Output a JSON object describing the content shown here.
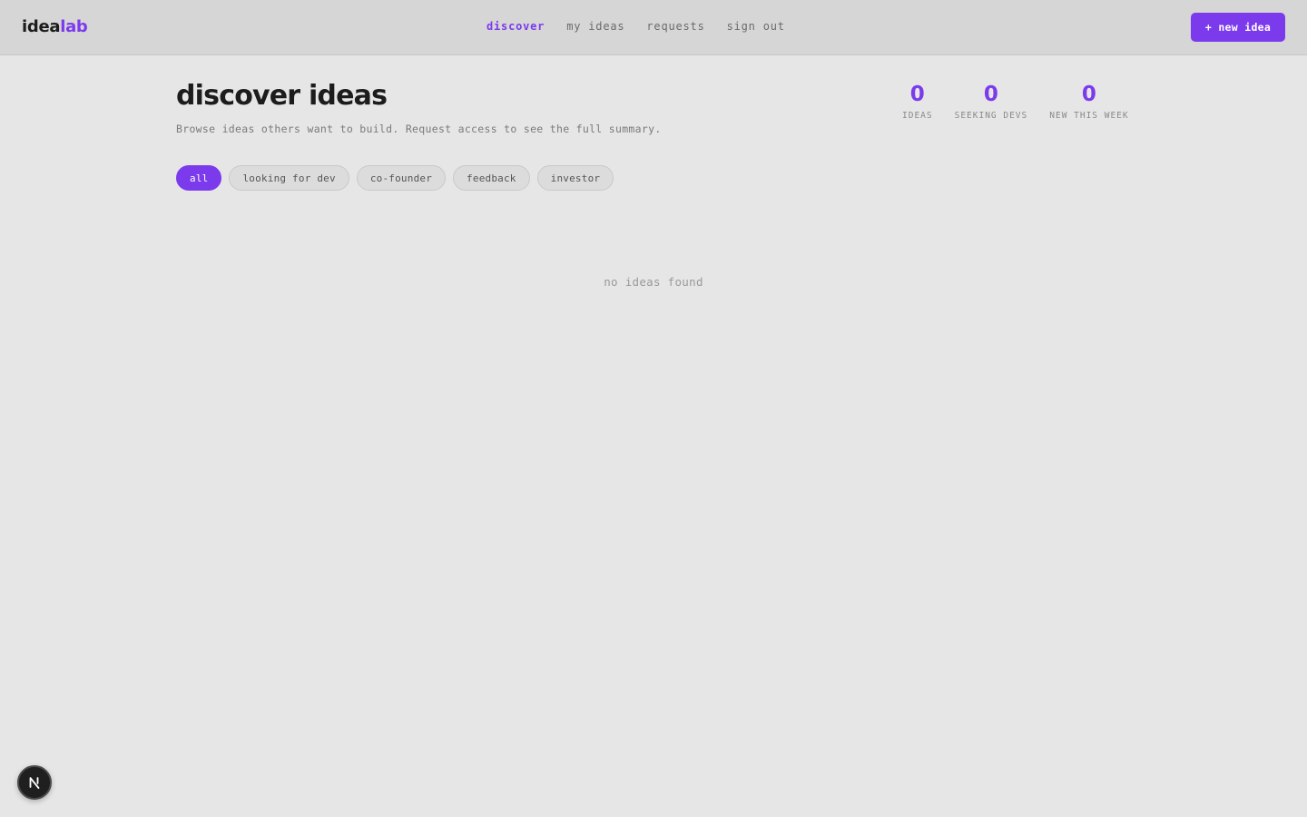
{
  "brand": {
    "name_main": "idea",
    "name_accent": "lab",
    "accent_color": "#7c3aed"
  },
  "nav": {
    "items": [
      {
        "label": "discover",
        "active": true
      },
      {
        "label": "my ideas",
        "active": false
      },
      {
        "label": "requests",
        "active": false
      },
      {
        "label": "sign out",
        "active": false
      }
    ],
    "new_idea_label": "+ new idea"
  },
  "header": {
    "title": "discover ideas",
    "subtitle": "Browse ideas others want to build. Request access to see the full summary."
  },
  "stats": [
    {
      "value": "0",
      "label": "IDEAS"
    },
    {
      "value": "0",
      "label": "SEEKING DEVS"
    },
    {
      "value": "0",
      "label": "NEW THIS WEEK"
    }
  ],
  "filters": [
    {
      "label": "all",
      "active": true
    },
    {
      "label": "looking for dev",
      "active": false
    },
    {
      "label": "co-founder",
      "active": false
    },
    {
      "label": "feedback",
      "active": false
    },
    {
      "label": "investor",
      "active": false
    }
  ],
  "empty_state": {
    "message": "no ideas found"
  },
  "dev_badge": {
    "icon": "nextjs-n-icon"
  }
}
